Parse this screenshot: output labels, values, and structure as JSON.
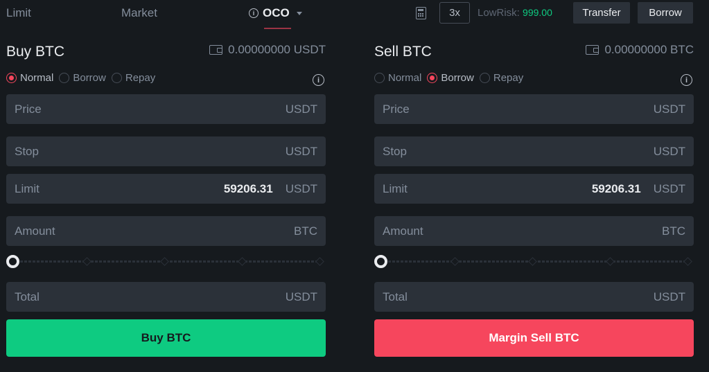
{
  "tabs": {
    "limit": "Limit",
    "market": "Market",
    "oco": "OCO"
  },
  "header": {
    "leverage": "3x",
    "lowrisk_label": "LowRisk:",
    "lowrisk_value": "999.00",
    "transfer": "Transfer",
    "borrow": "Borrow"
  },
  "buy": {
    "title": "Buy BTC",
    "balance": "0.00000000 USDT",
    "modes": [
      "Normal",
      "Borrow",
      "Repay"
    ],
    "active_mode": "Normal",
    "price": {
      "label": "Price",
      "value": "",
      "unit": "USDT"
    },
    "stop": {
      "label": "Stop",
      "value": "",
      "unit": "USDT"
    },
    "limit": {
      "label": "Limit",
      "value": "59206.31",
      "unit": "USDT"
    },
    "amount": {
      "label": "Amount",
      "value": "",
      "unit": "BTC"
    },
    "total": {
      "label": "Total",
      "value": "",
      "unit": "USDT"
    },
    "slider_percent": 0,
    "action": "Buy BTC"
  },
  "sell": {
    "title": "Sell BTC",
    "balance": "0.00000000 BTC",
    "modes": [
      "Normal",
      "Borrow",
      "Repay"
    ],
    "active_mode": "Borrow",
    "price": {
      "label": "Price",
      "value": "",
      "unit": "USDT"
    },
    "stop": {
      "label": "Stop",
      "value": "",
      "unit": "USDT"
    },
    "limit": {
      "label": "Limit",
      "value": "59206.31",
      "unit": "USDT"
    },
    "amount": {
      "label": "Amount",
      "value": "",
      "unit": "BTC"
    },
    "total": {
      "label": "Total",
      "value": "",
      "unit": "USDT"
    },
    "slider_percent": 0,
    "action": "Margin Sell BTC"
  },
  "colors": {
    "buy": "#0ecb81",
    "sell": "#f6465d",
    "background": "#161a1e",
    "input": "#2b3139"
  }
}
